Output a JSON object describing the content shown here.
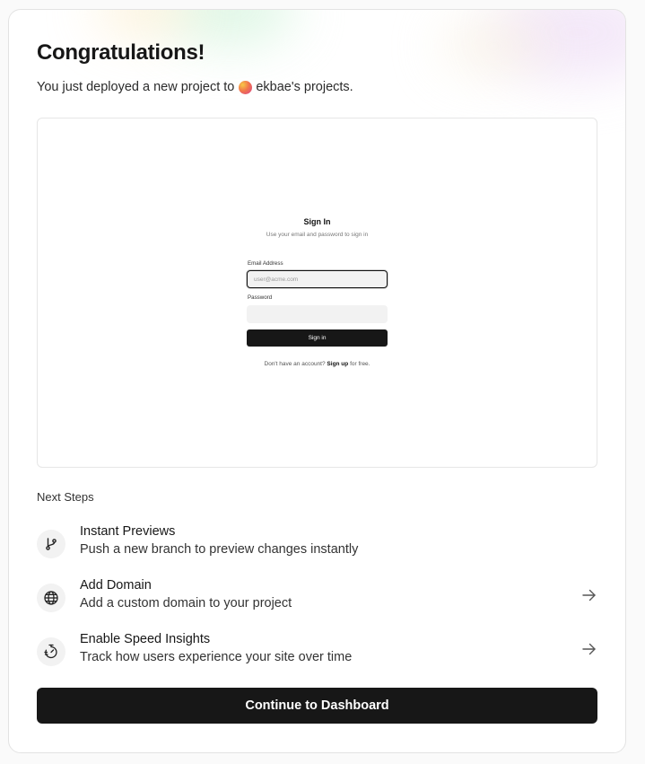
{
  "header": {
    "title": "Congratulations!",
    "subtitle_prefix": "You just deployed a new project to",
    "team_name": "ekbae's projects."
  },
  "preview": {
    "title": "Sign In",
    "subtitle": "Use your email and password to sign in",
    "email_label": "Email Address",
    "email_placeholder": "user@acme.com",
    "password_label": "Password",
    "button_label": "Sign in",
    "footer_prefix": "Don't have an account?",
    "footer_link": "Sign up",
    "footer_suffix": "for free."
  },
  "next_steps": {
    "heading": "Next Steps",
    "items": [
      {
        "icon": "git-branch-icon",
        "title": "Instant Previews",
        "description": "Push a new branch to preview changes instantly",
        "has_arrow": false
      },
      {
        "icon": "globe-icon",
        "title": "Add Domain",
        "description": "Add a custom domain to your project",
        "has_arrow": true
      },
      {
        "icon": "stopwatch-icon",
        "title": "Enable Speed Insights",
        "description": "Track how users experience your site over time",
        "has_arrow": true
      }
    ]
  },
  "actions": {
    "continue_label": "Continue to Dashboard"
  }
}
